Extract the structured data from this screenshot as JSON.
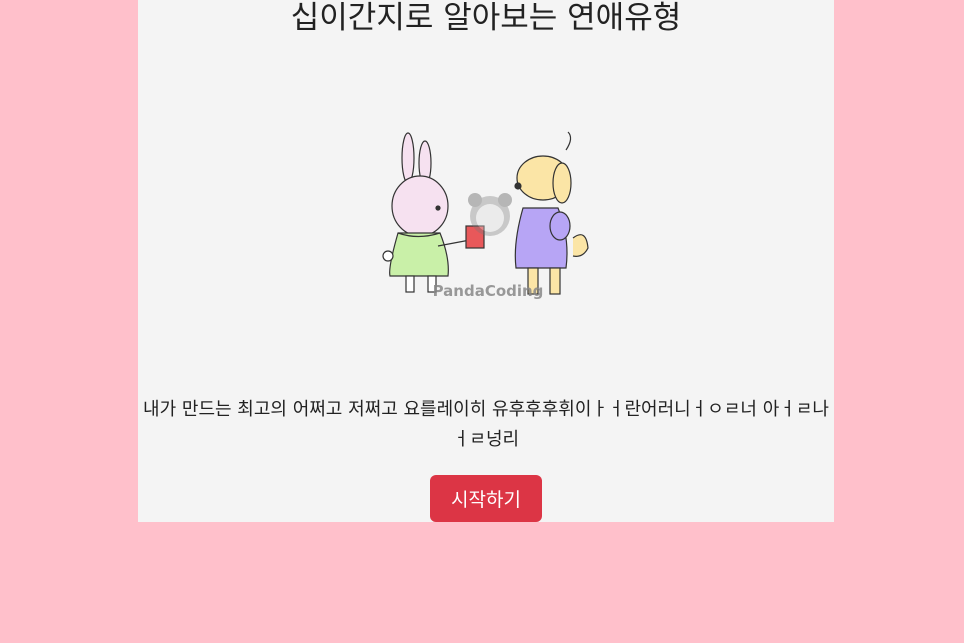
{
  "page": {
    "title": "십이간지로 알아보는 연애유형",
    "description": "내가 만드는 최고의 어쩌고 저쩌고 요를레이히 유후후후휘이ㅏㅓ란어러니ㅓㅇㄹ너 아ㅓㄹ나ㅓㄹ넝리",
    "start_label": "시작하기",
    "watermark": "PandaCoding"
  },
  "colors": {
    "background": "#ffc0cb",
    "card": "#f4f4f4",
    "button": "#dc3545"
  }
}
